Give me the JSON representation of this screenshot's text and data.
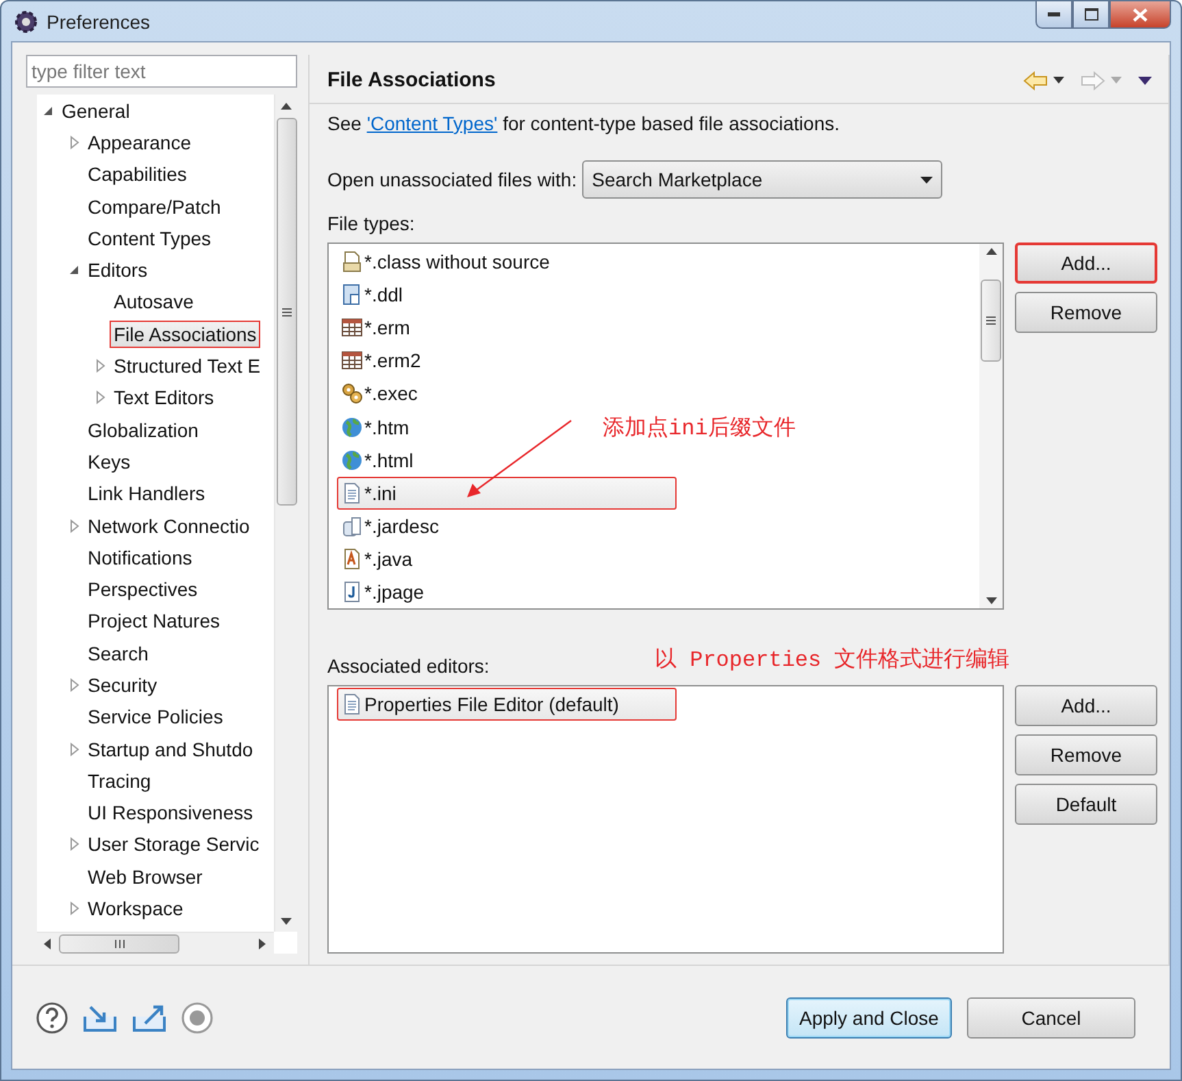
{
  "window": {
    "title": "Preferences"
  },
  "filter": {
    "placeholder": "type filter text"
  },
  "tree": [
    {
      "label": "General",
      "expanded": true,
      "selected": false,
      "marked": false,
      "children": [
        {
          "label": "Appearance",
          "expanded": false,
          "selected": false,
          "marked": false
        },
        {
          "label": "Capabilities",
          "selected": false,
          "marked": false
        },
        {
          "label": "Compare/Patch",
          "selected": false,
          "marked": false
        },
        {
          "label": "Content Types",
          "selected": false,
          "marked": false
        },
        {
          "label": "Editors",
          "expanded": true,
          "selected": false,
          "marked": false,
          "children": [
            {
              "label": "Autosave",
              "selected": false,
              "marked": false
            },
            {
              "label": "File Associations",
              "selected": true,
              "marked": true
            },
            {
              "label": "Structured Text E",
              "expanded": false,
              "selected": false,
              "marked": false
            },
            {
              "label": "Text Editors",
              "expanded": false,
              "selected": false,
              "marked": false
            }
          ]
        },
        {
          "label": "Globalization",
          "selected": false,
          "marked": false
        },
        {
          "label": "Keys",
          "selected": false,
          "marked": false
        },
        {
          "label": "Link Handlers",
          "selected": false,
          "marked": false
        },
        {
          "label": "Network Connectio",
          "expanded": false,
          "selected": false,
          "marked": false
        },
        {
          "label": "Notifications",
          "selected": false,
          "marked": false
        },
        {
          "label": "Perspectives",
          "selected": false,
          "marked": false
        },
        {
          "label": "Project Natures",
          "selected": false,
          "marked": false
        },
        {
          "label": "Search",
          "selected": false,
          "marked": false
        },
        {
          "label": "Security",
          "expanded": false,
          "selected": false,
          "marked": false
        },
        {
          "label": "Service Policies",
          "selected": false,
          "marked": false
        },
        {
          "label": "Startup and Shutdo",
          "expanded": false,
          "selected": false,
          "marked": false
        },
        {
          "label": "Tracing",
          "selected": false,
          "marked": false
        },
        {
          "label": "UI Responsiveness",
          "selected": false,
          "marked": false
        },
        {
          "label": "User Storage Servic",
          "expanded": false,
          "selected": false,
          "marked": false
        },
        {
          "label": "Web Browser",
          "selected": false,
          "marked": false
        },
        {
          "label": "Workspace",
          "expanded": false,
          "selected": false,
          "marked": false
        }
      ]
    }
  ],
  "page": {
    "title": "File Associations",
    "description_before": "See ",
    "link": "'Content Types'",
    "description_after": " for content-type based file associations.",
    "open_with": {
      "label": "Open unassociated files with:",
      "value": "Search Marketplace"
    },
    "file_types": {
      "label": "File types:",
      "items": [
        {
          "label": "*.class without source",
          "kind": "class",
          "selected": false,
          "marked": false
        },
        {
          "label": "*.ddl",
          "kind": "ddl",
          "selected": false,
          "marked": false
        },
        {
          "label": "*.erm",
          "kind": "table",
          "selected": false,
          "marked": false
        },
        {
          "label": "*.erm2",
          "kind": "table",
          "selected": false,
          "marked": false
        },
        {
          "label": "*.exec",
          "kind": "gears",
          "selected": false,
          "marked": false
        },
        {
          "label": "*.htm",
          "kind": "globe",
          "selected": false,
          "marked": false
        },
        {
          "label": "*.html",
          "kind": "globe",
          "selected": false,
          "marked": false
        },
        {
          "label": "*.ini",
          "kind": "text",
          "selected": true,
          "marked": true
        },
        {
          "label": "*.jardesc",
          "kind": "jar",
          "selected": false,
          "marked": false
        },
        {
          "label": "*.java",
          "kind": "java",
          "selected": false,
          "marked": false
        },
        {
          "label": "*.jpage",
          "kind": "jpage",
          "selected": false,
          "marked": false
        }
      ],
      "buttons": [
        {
          "label": "Add...",
          "marked": true
        },
        {
          "label": "Remove",
          "marked": false
        }
      ]
    },
    "editors": {
      "label": "Associated editors:",
      "items": [
        {
          "label": "Properties File Editor (default)",
          "kind": "text",
          "selected": true,
          "marked": true
        }
      ],
      "buttons": [
        {
          "label": "Add...",
          "marked": false
        },
        {
          "label": "Remove",
          "marked": false
        },
        {
          "label": "Default",
          "marked": false
        }
      ]
    }
  },
  "annotations": [
    {
      "text": "添加点ini后缀文件"
    },
    {
      "text": "以 Properties 文件格式进行编辑"
    }
  ],
  "footer": {
    "buttons": [
      {
        "label": "Apply and Close",
        "default": true
      },
      {
        "label": "Cancel",
        "default": false
      }
    ]
  }
}
